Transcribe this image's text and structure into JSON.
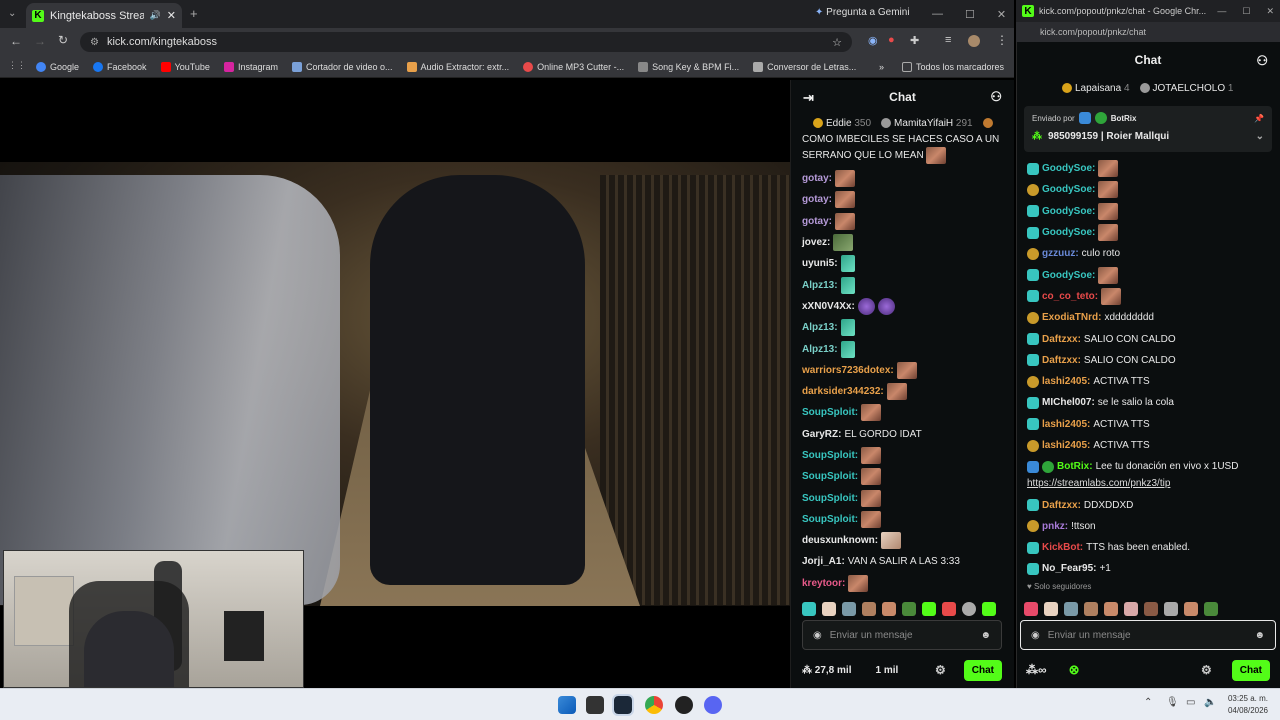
{
  "browser": {
    "tab_title": "Kingtekaboss Stream - Watc",
    "url": "kick.com/kingtekaboss",
    "gemini": "Pregunta a Gemini",
    "bookmarks": [
      "Google",
      "Facebook",
      "YouTube",
      "Instagram",
      "Cortador de video o...",
      "Audio Extractor: extr...",
      "Online MP3 Cutter -...",
      "Song Key & BPM Fi...",
      "Conversor de Letras..."
    ],
    "all_bookmarks": "Todos los marcadores"
  },
  "chat_left": {
    "title": "Chat",
    "leaders": [
      {
        "name": "Eddie",
        "pts": "350"
      },
      {
        "name": "MamitaYifaiH",
        "pts": "291"
      }
    ],
    "first_msg": "COMO IMBECILES SE HACES CASO A UN SERRANO QUE LO MEAN",
    "messages": [
      {
        "user": "gotay:",
        "color": "#b59ad8",
        "text": "",
        "emote": "e"
      },
      {
        "user": "gotay:",
        "color": "#b59ad8",
        "text": "",
        "emote": "e"
      },
      {
        "user": "gotay:",
        "color": "#b59ad8",
        "text": "",
        "emote": "e"
      },
      {
        "user": "jovez:",
        "color": "#e8e8e8",
        "text": "",
        "emote": "k"
      },
      {
        "user": "uyuni5:",
        "color": "#e8e8e8",
        "text": "",
        "emote": "g"
      },
      {
        "user": "Alpz13:",
        "color": "#7ad0c8",
        "text": "",
        "emote": "g"
      },
      {
        "user": "xXN0V4Xx:",
        "color": "#e8e8e8",
        "text": "",
        "emote": "p"
      },
      {
        "user": "Alpz13:",
        "color": "#7ad0c8",
        "text": "",
        "emote": "g"
      },
      {
        "user": "Alpz13:",
        "color": "#7ad0c8",
        "text": "",
        "emote": "g"
      },
      {
        "user": "warriors7236dotex:",
        "color": "#e8a04a",
        "text": "",
        "emote": "e"
      },
      {
        "user": "darksider344232:",
        "color": "#e8a04a",
        "text": "",
        "emote": "e"
      },
      {
        "user": "SoupSploit:",
        "color": "#38c6c0",
        "text": "",
        "emote": "e"
      },
      {
        "user": "GaryRZ:",
        "color": "#e8e8e8",
        "text": "EL GORDO IDAT",
        "emote": ""
      },
      {
        "user": "SoupSploit:",
        "color": "#38c6c0",
        "text": "",
        "emote": "e"
      },
      {
        "user": "SoupSploit:",
        "color": "#38c6c0",
        "text": "",
        "emote": "e"
      },
      {
        "user": "SoupSploit:",
        "color": "#38c6c0",
        "text": "",
        "emote": "e"
      },
      {
        "user": "SoupSploit:",
        "color": "#38c6c0",
        "text": "",
        "emote": "e"
      },
      {
        "user": "deusxunknown:",
        "color": "#e8e8e8",
        "text": "",
        "emote": "f"
      },
      {
        "user": "Jorji_A1:",
        "color": "#e8e8e8",
        "text": "VAN A SALIR A LAS 3:33",
        "emote": ""
      },
      {
        "user": "kreytoor:",
        "color": "#e85a8a",
        "text": "",
        "emote": "e"
      }
    ],
    "input_placeholder": "Enviar un mensaje",
    "viewers": "27,8 mil",
    "followers": "1 mil",
    "chat_button": "Chat"
  },
  "chat_right": {
    "window_title": "kick.com/popout/pnkz/chat - Google Chr...",
    "url": "kick.com/popout/pnkz/chat",
    "title": "Chat",
    "leaders": [
      {
        "name": "Lapaisana",
        "pts": "4"
      },
      {
        "name": "JOTAELCHOLO",
        "pts": "1"
      }
    ],
    "pinned_label": "Enviado por",
    "pinned_by": "BotRix",
    "pinned_text": "985099159 | Roier Mallqui",
    "messages": [
      {
        "user": "GoodySoe:",
        "color": "#38c6c0",
        "text": "",
        "emote": "e"
      },
      {
        "user": "GoodySoe:",
        "color": "#38c6c0",
        "text": "",
        "emote": "e"
      },
      {
        "user": "GoodySoe:",
        "color": "#38c6c0",
        "text": "",
        "emote": "e"
      },
      {
        "user": "GoodySoe:",
        "color": "#38c6c0",
        "text": "",
        "emote": "e"
      },
      {
        "user": "gzzuuz:",
        "color": "#6a8ad8",
        "text": "culo roto",
        "emote": ""
      },
      {
        "user": "GoodySoe:",
        "color": "#38c6c0",
        "text": "",
        "emote": "e"
      },
      {
        "user": "co_co_teto:",
        "color": "#e84a4a",
        "text": "",
        "emote": "e"
      },
      {
        "user": "ExodiaTNrd:",
        "color": "#e8a04a",
        "text": "xdddddddd",
        "emote": ""
      },
      {
        "user": "Daftzxx:",
        "color": "#e8a04a",
        "text": "SALIO CON CALDO",
        "emote": ""
      },
      {
        "user": "Daftzxx:",
        "color": "#e8a04a",
        "text": "SALIO CON CALDO",
        "emote": ""
      },
      {
        "user": "lashi2405:",
        "color": "#e8a04a",
        "text": "ACTIVA TTS",
        "emote": ""
      },
      {
        "user": "MIChel007:",
        "color": "#e8e8e8",
        "text": "se le salio la cola",
        "emote": ""
      },
      {
        "user": "lashi2405:",
        "color": "#e8a04a",
        "text": "ACTIVA TTS",
        "emote": ""
      },
      {
        "user": "lashi2405:",
        "color": "#e8a04a",
        "text": "ACTIVA TTS",
        "emote": ""
      }
    ],
    "botrix_user": "BotRix:",
    "botrix_text": "Lee tu donación en vivo x 1USD",
    "botrix_link": "https://streamlabs.com/pnkz3/tip",
    "messages2": [
      {
        "user": "Daftzxx:",
        "color": "#e8a04a",
        "text": "DDXDDXD"
      },
      {
        "user": "pnkz:",
        "color": "#a87ad8",
        "text": "!ttson"
      },
      {
        "user": "KickBot:",
        "color": "#e84a4a",
        "text": "TTS has been enabled."
      },
      {
        "user": "No_Fear95:",
        "color": "#e8e8e8",
        "text": "+1"
      }
    ],
    "followers_only": "Solo seguidores",
    "input_placeholder": "Enviar un mensaje",
    "chat_button": "Chat"
  },
  "taskbar": {
    "time": "03:25 a. m.",
    "date": "04/08/2026"
  }
}
